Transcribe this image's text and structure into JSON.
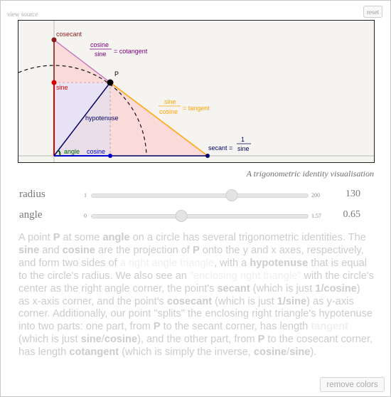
{
  "header": {
    "view_source": "view source",
    "reset": "reset"
  },
  "diagram": {
    "labels": {
      "cosecant": "cosecant",
      "cotangent_num": "cosine",
      "cotangent_den": "sine",
      "cotangent_eq": "= cotangent",
      "p": "P",
      "sine": "sine",
      "hypotenuse": "hypotenuse",
      "tangent_num": "sine",
      "tangent_den": "cosine",
      "tangent_eq": "= tangent",
      "angle": "angle",
      "cosine": "cosine",
      "secant_eq": "secant =",
      "secant_num": "1",
      "secant_den": "sine"
    },
    "colors": {
      "cosecant": "#8b1a1a",
      "cotangent": "#800080",
      "sine": "#dd0000",
      "tangent": "#ffa500",
      "cosine": "#0000cc",
      "secant": "#000066",
      "angle": "#006400",
      "enclosing_fill": "#fbd6d6",
      "inner_fill": "#d8dcf5"
    }
  },
  "caption": "A trigonometric identity visualisation",
  "sliders": [
    {
      "label": "radius",
      "min": "1",
      "max": "200",
      "value": "130",
      "fraction": 0.648
    },
    {
      "label": "angle",
      "min": "0",
      "max": "1.57",
      "value": "0.65",
      "fraction": 0.414
    }
  ],
  "description": {
    "s1": "A point ",
    "P1": "P",
    "s2": " at some ",
    "angle": "angle",
    "s3": " on a circle has several trigonometric identities. The ",
    "sine": "sine",
    "s4": " and ",
    "cosine": "cosine",
    "s5": " are the projection of ",
    "P2": "P",
    "s6": " onto the y and x axes, respectively, and form two sides of ",
    "right_triangle": "a right angle triangle",
    "s7": ", with a ",
    "hypotenuse": "hypotenuse",
    "s8": " that is equal to the circle's radius. We also see an ",
    "enclosing": "\"enclosing right triangle\"",
    "s9": " with the circle's center as the right angle corner, the point's ",
    "secant": "secant",
    "s10": " (which is just ",
    "one_cosine": "1/cosine",
    "s11": ") as x-axis corner, and the point's ",
    "cosecant": "cosecant",
    "s12": " (which is just ",
    "one_sine": "1/sine",
    "s13": ") as y-axis corner. Additionally, our point \"splits\" the enclosing right triangle's hypotenuse into two parts: one part, from ",
    "P3": "P",
    "s14": " to the secant corner, has length ",
    "tangent": "tangent",
    "s15": " (which is just ",
    "sine_cos_a": "sine",
    "slash1": "/",
    "sine_cos_b": "cosine",
    "s16": "), and the other part, from ",
    "P4": "P",
    "s17": " to the cosecant corner, has length ",
    "cotangent": "cotangent",
    "s18": " (which is simply the inverse, ",
    "cos_sine_a": "cosine",
    "slash2": "/",
    "cos_sine_b": "sine",
    "s19": ")."
  },
  "footer": {
    "remove_colors": "remove colors"
  }
}
